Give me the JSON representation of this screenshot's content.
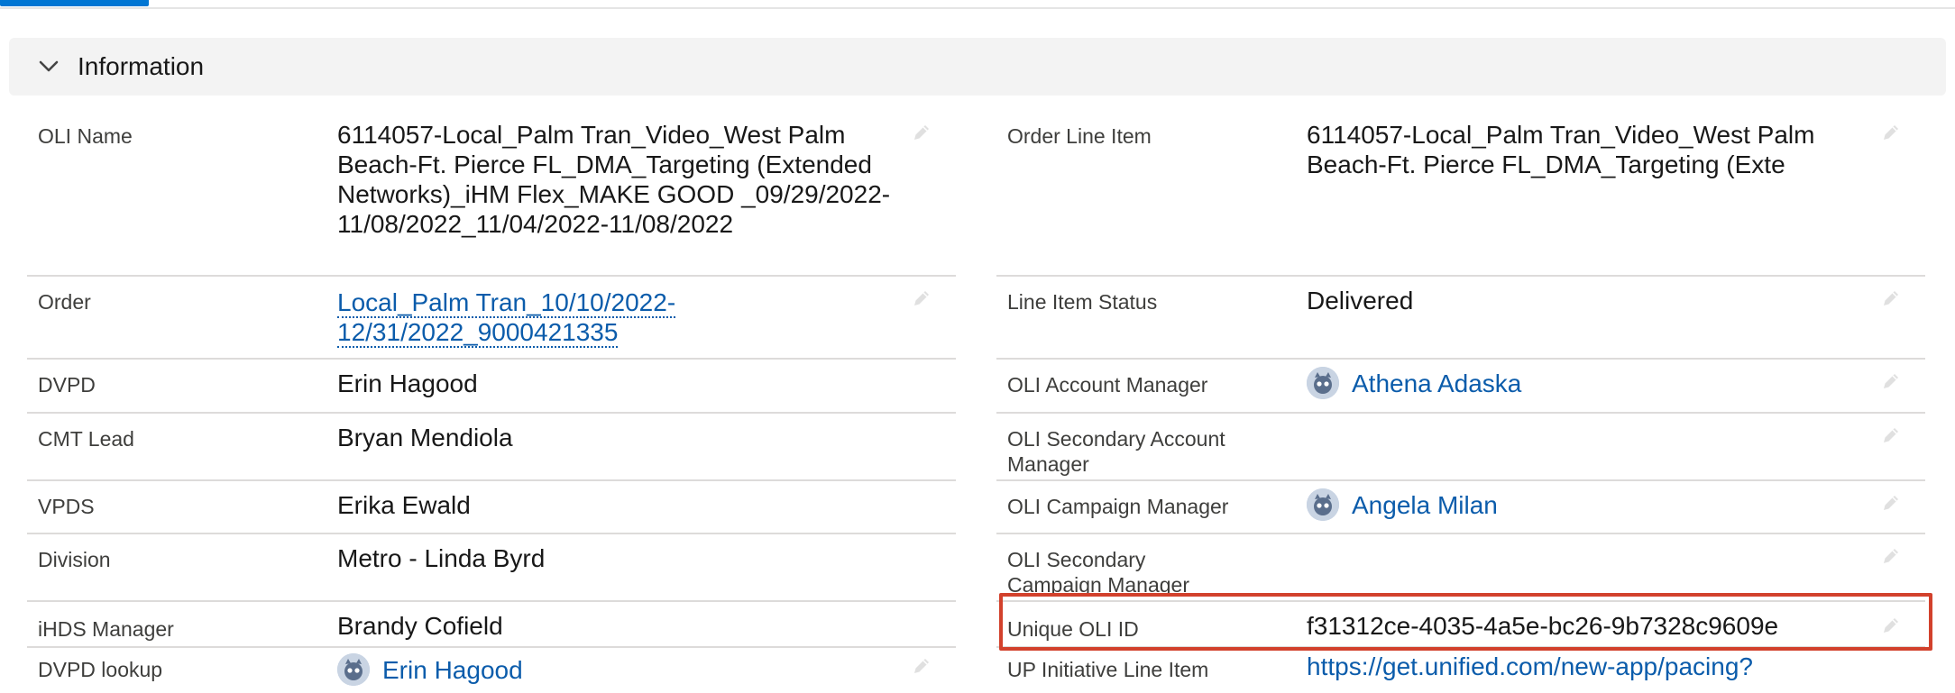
{
  "section": {
    "title": "Information"
  },
  "left_fields": [
    {
      "label": "OLI Name",
      "value": "6114057-Local_Palm Tran_Video_West Palm Beach-Ft. Pierce FL_DMA_Targeting (Extended Networks)_iHM Flex_MAKE GOOD _09/29/2022-11/08/2022_11/04/2022-11/08/2022"
    },
    {
      "label": "Order",
      "value": "Local_Palm Tran_10/10/2022-12/31/2022_9000421335"
    },
    {
      "label": "DVPD",
      "value": "Erin Hagood"
    },
    {
      "label": "CMT Lead",
      "value": "Bryan Mendiola"
    },
    {
      "label": "VPDS",
      "value": "Erika Ewald"
    },
    {
      "label": "Division",
      "value": "Metro - Linda Byrd"
    },
    {
      "label": "iHDS Manager",
      "value": "Brandy Cofield"
    },
    {
      "label": "DVPD lookup",
      "value": "Erin Hagood"
    }
  ],
  "right_fields": [
    {
      "label": "Order Line Item",
      "value": "6114057-Local_Palm Tran_Video_West Palm Beach-Ft. Pierce FL_DMA_Targeting (Exte"
    },
    {
      "label": "Line Item Status",
      "value": "Delivered"
    },
    {
      "label": "OLI Account Manager",
      "value": "Athena Adaska"
    },
    {
      "label": "OLI Secondary Account Manager",
      "value": ""
    },
    {
      "label": "OLI Campaign Manager",
      "value": "Angela Milan"
    },
    {
      "label": "OLI Secondary Campaign Manager",
      "value": ""
    },
    {
      "label": "Unique OLI ID",
      "value": "f31312ce-4035-4a5e-bc26-9b7328c9609e"
    },
    {
      "label": "UP Initiative Line Item",
      "value": "https://get.unified.com/new-app/pacing?"
    }
  ],
  "colors": {
    "link": "#0b5cab",
    "accent": "#0176d3",
    "highlight": "#d2412c"
  },
  "icons": {
    "collapse": "chevron-down-icon",
    "edit": "pencil-icon",
    "user": "user-avatar-icon"
  }
}
